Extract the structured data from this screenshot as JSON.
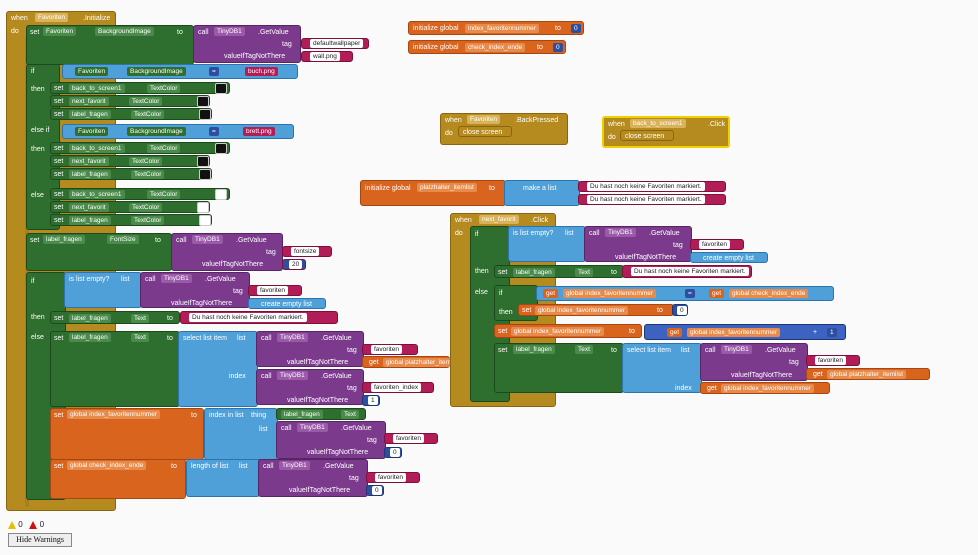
{
  "kw": {
    "when": "when",
    "do": "do",
    "set": "set",
    "to": "to",
    "call": "call",
    "if": "if",
    "then": "then",
    "else": "else",
    "else_if": "else if",
    "initialize_global": "initialize global",
    "get": "get",
    "is_list_empty": "is list empty?",
    "list": "list",
    "select_list_item": "select list item",
    "index": "index",
    "index_in_list": "index in list",
    "thing": "thing",
    "length_of_list": "length of list",
    "make_a_list": "make a list",
    "create_empty_list": "create empty list",
    "close_screen": "close screen",
    "eq": "=",
    "plus": "+"
  },
  "comp": {
    "favoriten": "Favoriten",
    "tinydb": "TinyDB1",
    "back": "back_to_screen1",
    "next": "next_favorit",
    "label": "label_fragen"
  },
  "prop": {
    "initialize": ".Initialize",
    "bg": "BackgroundImage",
    "getvalue": ".GetValue",
    "textcolor": "TextColor",
    "fontsize": "FontSize",
    "text": "Text",
    "backpressed": ".BackPressed",
    "click": ".Click"
  },
  "param": {
    "tag": "tag",
    "vitnt": "valueIfTagNotThere"
  },
  "vals": {
    "default_wallpaper": "defaultwallpaper",
    "wall": "wall.png",
    "buch": "buch.png",
    "brett": "brett.png",
    "fontsize": "fontsize",
    "twenty": "20",
    "favoriten": "favoriten",
    "favoriten_index": "favoriten_index",
    "no_favs": "Du hast noch keine Favoriten markiert.",
    "zero": "0",
    "one": "1"
  },
  "globals": {
    "index_fav": "index_favoritennummer",
    "check_idx": "check_index_ende",
    "platzhalter": "platzhalter_itemlist",
    "g_index_fav": "global index_favoritennummer",
    "g_check_idx": "global check_index_ende",
    "g_platzhalter": "global platzhalter_itemlist"
  },
  "warnings": {
    "warn_count": "0",
    "error_count": "0",
    "hide_label": "Hide Warnings"
  },
  "colors": {
    "event": "#b58a1e",
    "set": "#2e6e2e",
    "text": "#b21c57",
    "procedure": "#7b3a8c",
    "variable": "#d8641e",
    "list": "#4fa0d8"
  }
}
